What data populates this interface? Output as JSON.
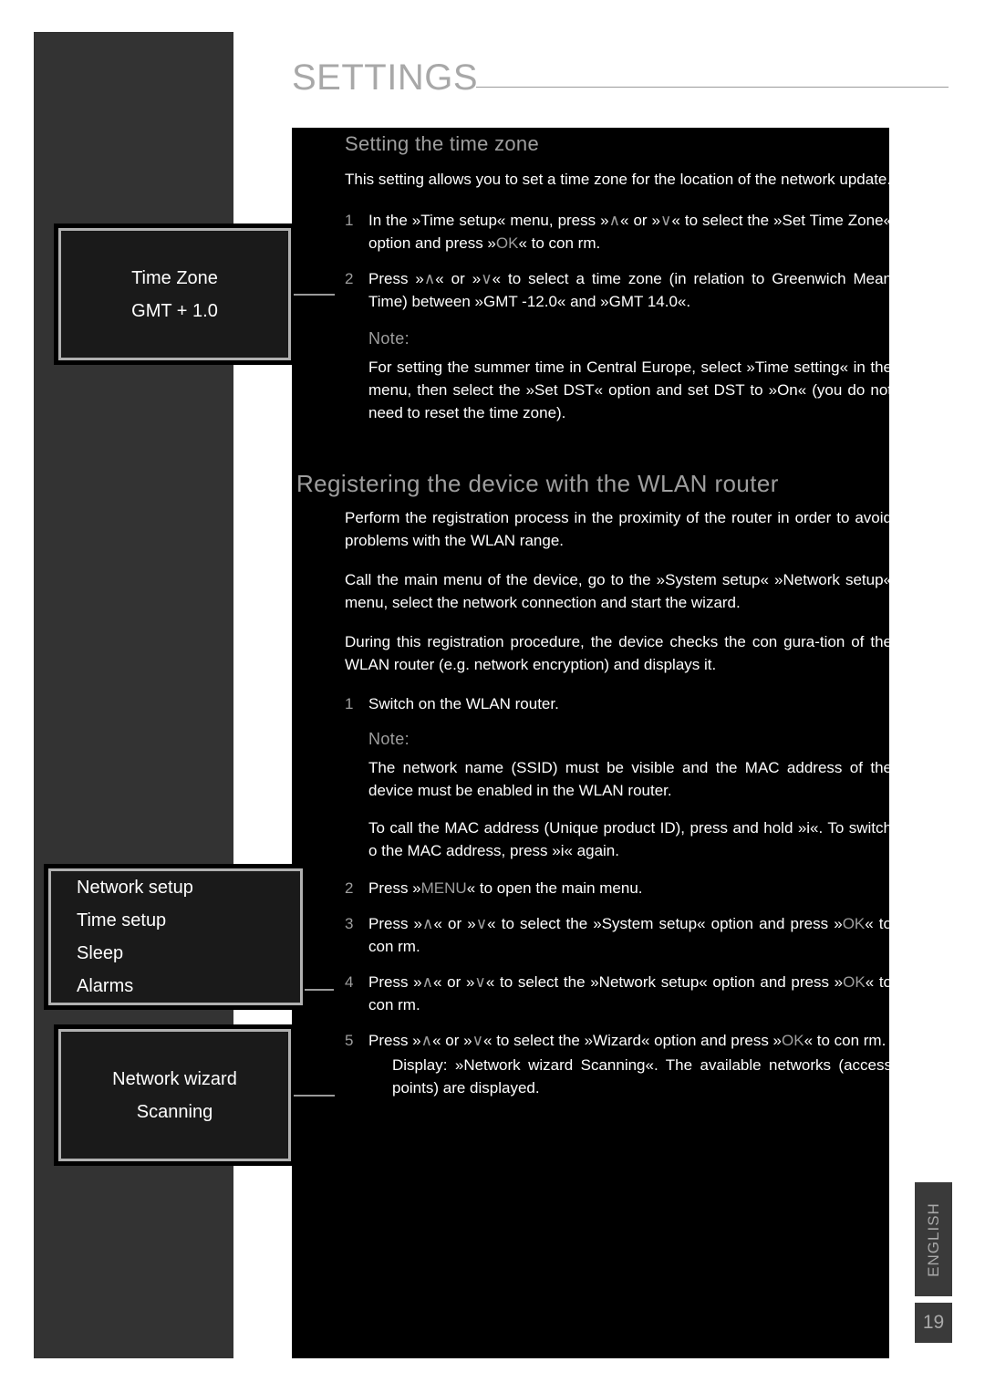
{
  "header": {
    "title": "SETTINGS"
  },
  "sections": {
    "time_zone": {
      "heading": "Setting the time zone",
      "intro": "This setting allows you to set a time zone for the location of the network update.",
      "steps": [
        {
          "num": "1",
          "text_a": "In the »Time setup« menu, press »",
          "key_1": "∧",
          "text_b": "« or »",
          "key_2": "∨",
          "text_c": "« to select the »Set Time Zone« option and press »",
          "key_3": "OK",
          "text_d": "« to con rm."
        },
        {
          "num": "2",
          "text_a": "Press »",
          "key_1": "∧",
          "text_b": "« or »",
          "key_2": "∨",
          "text_c": "« to select a time zone (in relation to Greenwich Mean Time) between »GMT -12.0« and »GMT 14.0«."
        }
      ],
      "note_label": "Note:",
      "note_text": "For setting the summer time in Central Europe, select »Time setting« in the menu, then select the »Set DST« option and set DST to »On« (you do not need to reset the time zone)."
    },
    "wlan": {
      "heading": "Registering the device with the WLAN router",
      "para_1": "Perform the registration process in the proximity of the router in order to avoid problems with the WLAN range.",
      "para_2": "Call the main menu of the device, go to the »System setup«    »Network setup« menu, select the network connection and start the wizard.",
      "para_3": "During this registration procedure, the device checks the con gura-tion of the WLAN router (e.g. network encryption) and displays it.",
      "step_1": {
        "num": "1",
        "text": "Switch on the WLAN router."
      },
      "note_label": "Note:",
      "note_text_1": "The network name (SSID) must be visible and the MAC address of the device must be enabled in the WLAN router.",
      "note_text_2": "To call the MAC address (Unique product ID), press and hold »i«. To switch o  the MAC address, press »i« again.",
      "step_2": {
        "num": "2",
        "text_a": "Press »",
        "key_1": "MENU",
        "text_b": "« to open the main menu."
      },
      "step_3": {
        "num": "3",
        "text_a": "Press »",
        "key_1": "∧",
        "text_b": "« or »",
        "key_2": "∨",
        "text_c": "« to select the »System setup« option and press »",
        "key_3": "OK",
        "text_d": "« to con rm."
      },
      "step_4": {
        "num": "4",
        "text_a": "Press »",
        "key_1": "∧",
        "text_b": "« or »",
        "key_2": "∨",
        "text_c": "« to select the »Network setup« option and press »",
        "key_3": "OK",
        "text_d": "« to con rm."
      },
      "step_5": {
        "num": "5",
        "text_a": "Press »",
        "key_1": "∧",
        "text_b": "« or »",
        "key_2": "∨",
        "text_c": "« to select the »Wizard« option and press »",
        "key_3": "OK",
        "text_d": "« to con rm.",
        "display_note": "Display: »Network wizard Scanning«. The available networks (access points) are displayed."
      }
    }
  },
  "lcd_boxes": {
    "time_zone": {
      "line_1": "Time Zone",
      "line_2": "GMT + 1.0"
    },
    "system_menu": {
      "line_1": "Network setup",
      "line_2": "Time setup",
      "line_3": "Sleep",
      "line_4": "Alarms"
    },
    "wizard": {
      "line_1": "Network wizard",
      "line_2": "Scanning"
    }
  },
  "footer": {
    "language": "ENGLISH",
    "page_number": "19"
  },
  "colors": {
    "gray_column": "#333333",
    "panel": "#000000",
    "heading_gray": "#9e9e9e",
    "body_white": "#ffffff",
    "lcd_bg": "#1a1a1a",
    "lcd_border": "#b0b0b0",
    "tab_bg": "#3a3a3a"
  }
}
